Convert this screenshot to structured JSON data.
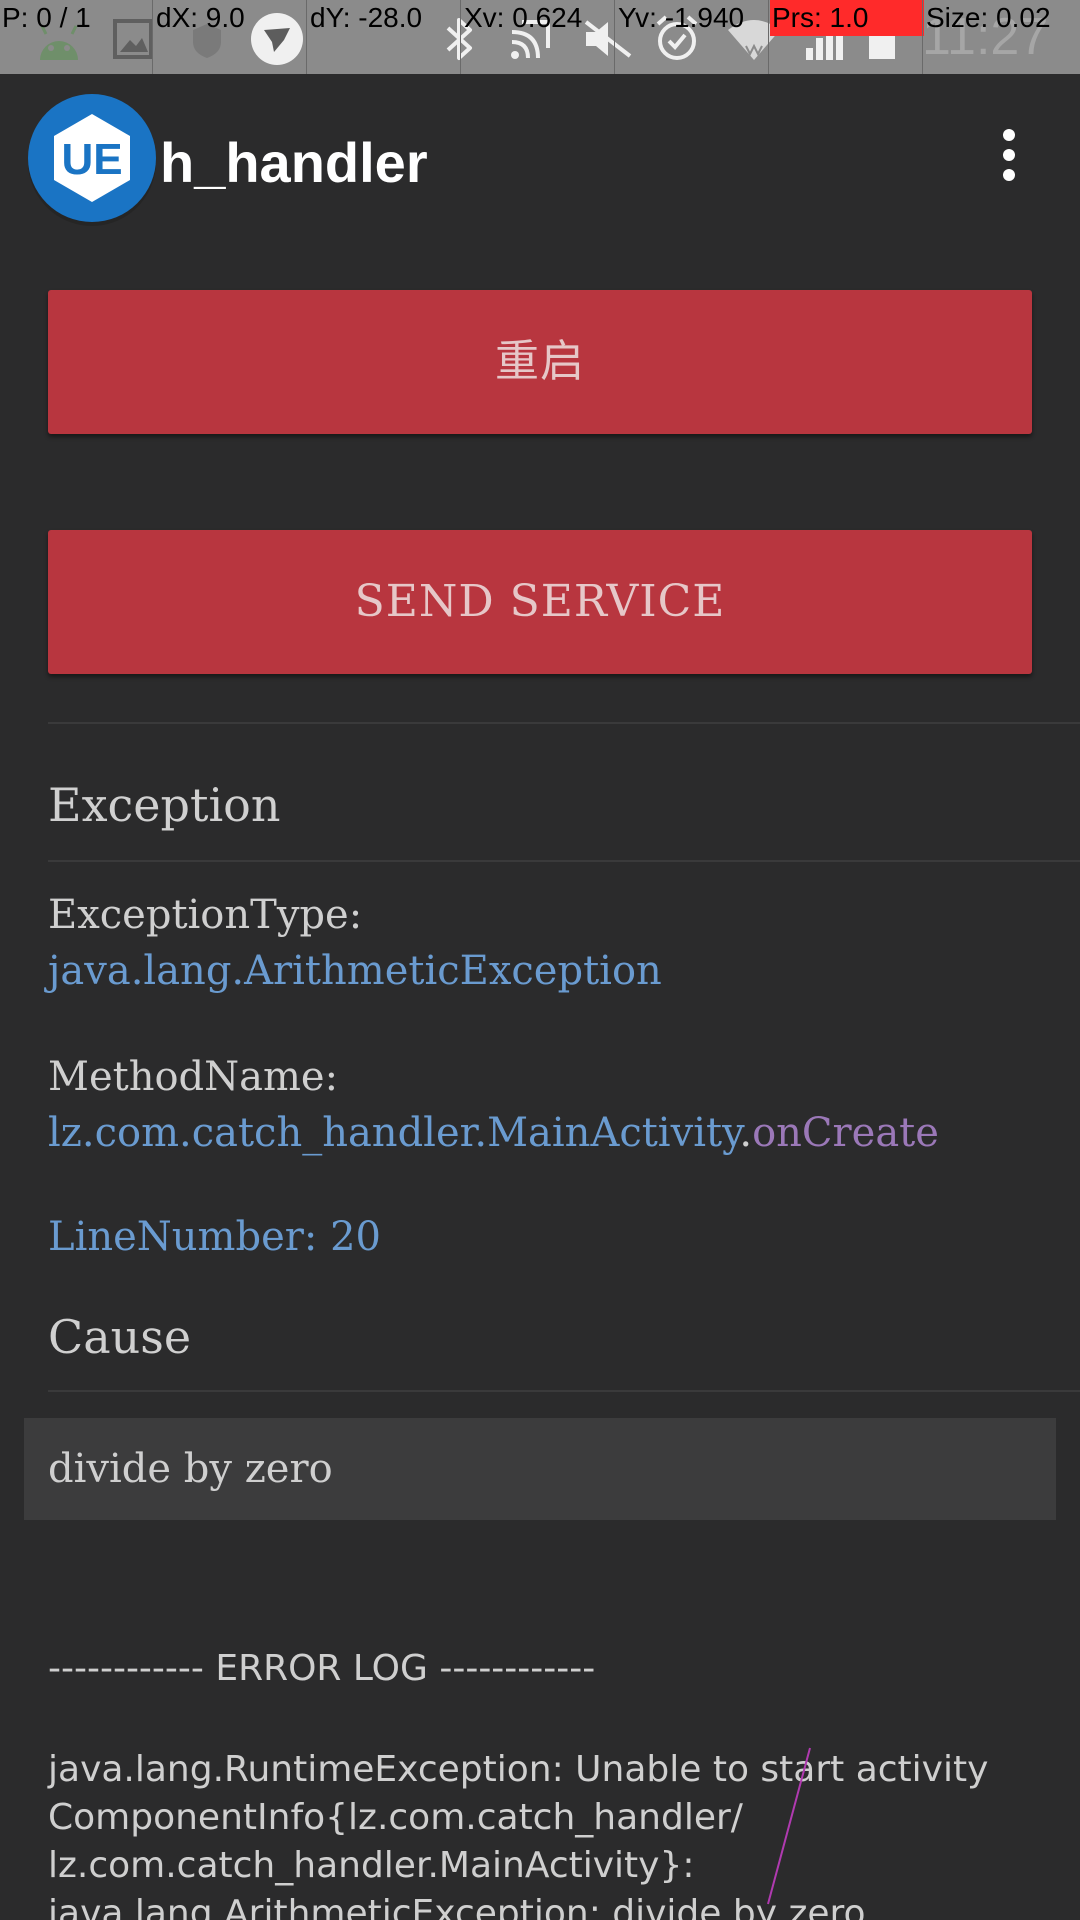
{
  "pointer_overlay": {
    "pointer": "P: 0 / 1",
    "dx": "dX: 9.0",
    "dy": "dY: -28.0",
    "xv": "Xv: 0.624",
    "yv": "Yv: -1.940",
    "prs": "Prs: 1.0",
    "size": "Size: 0.02"
  },
  "status_bar": {
    "time": "11:27",
    "icons": [
      "android-icon",
      "gallery-icon",
      "shield-icon",
      "bird-app-icon",
      "bluetooth-icon",
      "cast-icon",
      "mute-icon",
      "alarm-icon",
      "wifi-icon",
      "signal-icon",
      "battery-icon"
    ]
  },
  "app_bar": {
    "title": "h_handler",
    "badge_text": "UE"
  },
  "buttons": {
    "restart": "重启",
    "send_service": "SEND SERVICE"
  },
  "exception": {
    "heading": "Exception",
    "type_label": "ExceptionType:",
    "type_value": "java.lang.ArithmeticException",
    "method_label": "MethodName:",
    "method_class": "lz.com.catch_handler.MainActivity",
    "method_dot": ".",
    "method_name": "onCreate",
    "line_number": "LineNumber: 20"
  },
  "cause": {
    "heading": "Cause",
    "message": "divide by zero"
  },
  "error_log": {
    "title": "------------ ERROR LOG ------------",
    "lines": [
      "java.lang.RuntimeException: Unable to start activity",
      "ComponentInfo{lz.com.catch_handler/",
      "lz.com.catch_handler.MainActivity}:",
      "java.lang.ArithmeticException: divide by zero"
    ]
  },
  "colors": {
    "background": "#2b2b2c",
    "button": "#b8363f",
    "link_blue": "#6a9bd0",
    "method_purple": "#9b78b8",
    "badge_blue": "#1a74c4",
    "pointer_highlight": "#ff2a2a"
  }
}
